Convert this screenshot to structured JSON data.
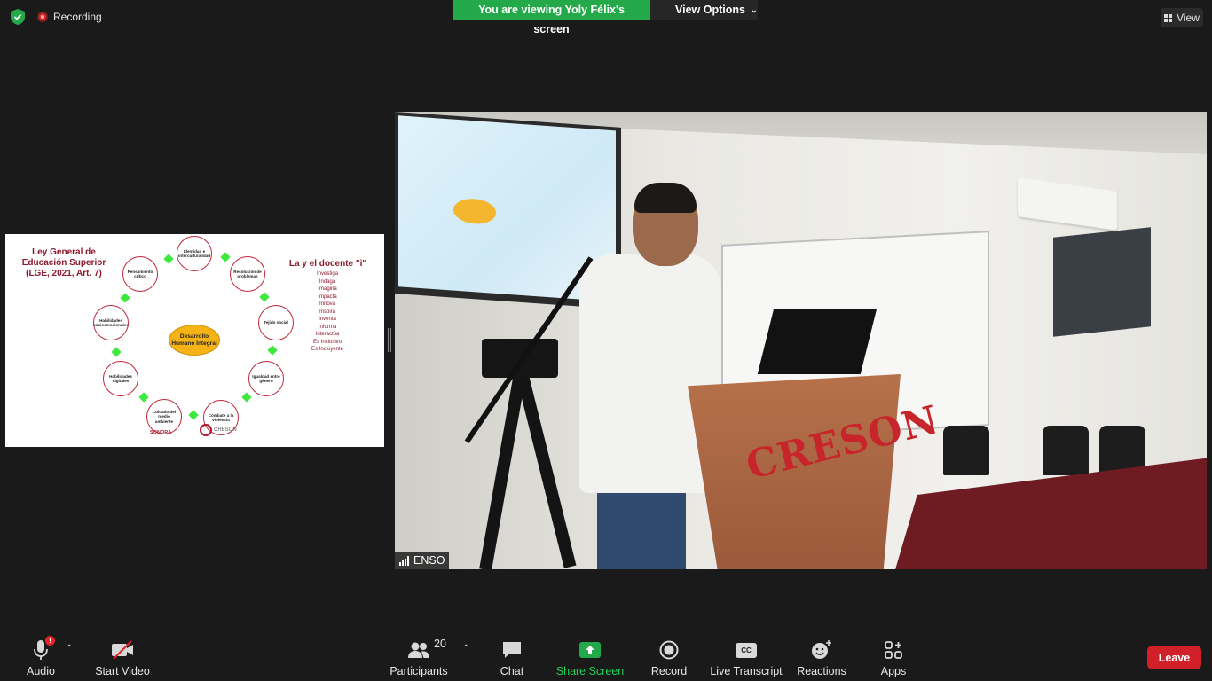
{
  "top": {
    "recording_label": "Recording",
    "viewing_banner": "You are viewing Yoly Félix's screen",
    "view_options_label": "View Options",
    "view_label": "View"
  },
  "slide": {
    "title_left": "Ley General de Educación Superior (LGE, 2021, Art. 7)",
    "title_right": "La y el docente \"i\"",
    "i_list": [
      "Investiga",
      "Indaga",
      "Imagina",
      "Impacta",
      "Innova",
      "Inspira",
      "Inventa",
      "Informa",
      "Interactúa",
      "Es Inclusivo",
      "Es Incluyente"
    ],
    "center": "Desarrollo Humano Integral",
    "nodes": [
      "Identidad e interculturalidad",
      "Resolución de problemas",
      "Tejido social",
      "Igualdad entre género",
      "Combate a la violencia",
      "Cuidado del medio ambiente",
      "Habilidades digitales",
      "Habilidades socioemocionales",
      "Pensamiento crítico"
    ],
    "logo_left": "SONORA",
    "logo_right": "CRESON"
  },
  "video": {
    "participant_name": "ENSO",
    "podium_text": "CRESON"
  },
  "toolbar": {
    "audio": "Audio",
    "start_video": "Start Video",
    "participants": "Participants",
    "participants_count": "20",
    "chat": "Chat",
    "share_screen": "Share Screen",
    "record": "Record",
    "live_transcript": "Live Transcript",
    "reactions": "Reactions",
    "apps": "Apps",
    "leave": "Leave",
    "cc_text": "CC",
    "alert_mark": "!"
  },
  "colors": {
    "viewing_banner": "#23a94a",
    "leave": "#d2202a",
    "slide_accent": "#8c1a2e",
    "center_node": "#f5b316"
  }
}
